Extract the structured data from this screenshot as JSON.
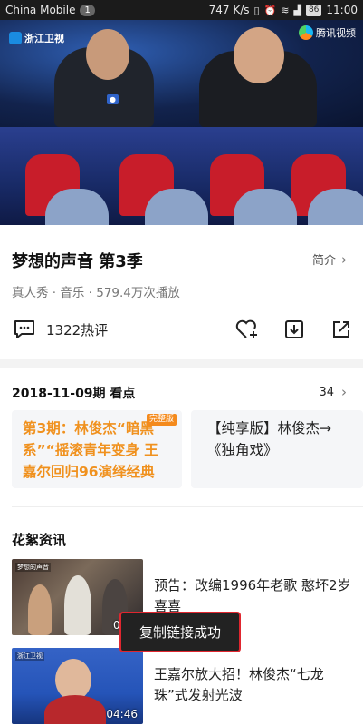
{
  "status_bar": {
    "carrier": "China Mobile",
    "sim_slot": "1",
    "speed": "747 K/s",
    "battery": "86",
    "time": "11:00"
  },
  "video": {
    "channel_logo": "浙江卫视",
    "app_logo": "腾讯视频"
  },
  "show": {
    "title": "梦想的声音 第3季",
    "intro_label": "简介",
    "meta": "真人秀 · 音乐 · 579.4万次播放",
    "comments_label": "1322热评"
  },
  "episode": {
    "heading": "2018-11-09期 看点",
    "count": "34",
    "cards": [
      {
        "text": "第3期：林俊杰“暗黑系”“摇滚青年变身 王嘉尔回归96演绎经典",
        "badge": "完整版"
      },
      {
        "text": "【纯享版】林俊杰→《独角戏》"
      }
    ]
  },
  "news": {
    "heading": "花絮资讯",
    "items": [
      {
        "title": "预告：改编1996年老歌 憨坏2岁喜喜",
        "duration": "00:1",
        "thumb_logo": "梦想的声音"
      },
      {
        "title": "王嘉尔放大招！林俊杰“七龙珠”式发射光波",
        "duration": "04:46",
        "thumb_logo": "浙江卫视"
      }
    ]
  },
  "toast": {
    "text": "复制链接成功"
  },
  "colors": {
    "accent_orange": "#f0911e",
    "toast_border": "#e0262f"
  },
  "icons": [
    "comment-icon",
    "favorite-add-icon",
    "download-icon",
    "share-icon",
    "chevron-right-icon"
  ]
}
